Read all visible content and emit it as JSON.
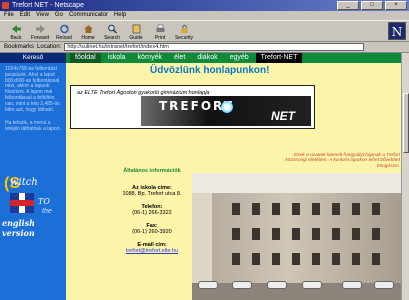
{
  "window": {
    "title": "Trefort NET - Netscape",
    "controls": [
      "_",
      "□",
      "×"
    ]
  },
  "menu": [
    "File",
    "Edit",
    "View",
    "Go",
    "Communicator",
    "Help"
  ],
  "toolbar": {
    "buttons": [
      "Back",
      "Forward",
      "Reload",
      "Home",
      "Search",
      "Guide",
      "Print",
      "Security"
    ],
    "throbber": "N"
  },
  "location": {
    "bookmarks_label": "Bookmarks",
    "location_label": "Location:",
    "url": "http://sulinet.hu/intranet/trefort/index4.htm"
  },
  "left_panel": {
    "title": "Kereső",
    "text1": "1024x768-as felbontást javaslunk. Ahol a lapot 800x600-as felbontással nézi, akkor a lapunk frissíteni. A lapon mai felbontással a feltöltés van, mint a kép 2,485-ös bitre azt, hogy látható.",
    "text2": "Ha tetszik, a menü a tetején láthatóak a lapon.",
    "switch_word": "witch",
    "switch_to": "TO",
    "switch_the": "the",
    "switch_english": "english version"
  },
  "tabs": [
    "főoldal",
    "iskola",
    "környék",
    "élet",
    "diákok",
    "egyéb",
    "Trefort-NET"
  ],
  "main": {
    "welcome": "Üdvözlünk honlapunkon!",
    "banner_subtitle": "az ELTE Trefort Ágoston gyakorló gimnázium honlapja",
    "logo_left": "TREFORT",
    "logo_right": "NET",
    "red_note": "Ezek a rovatok kiemelt hangsúlyt kapnak a Trefort közösségi életében. A konkrét lapokon lehet bővebbet böngészni.",
    "info_head": "Általános információk",
    "addr_label": "Az iskola címe:",
    "addr_value": "1088, Bp. Trefort utca 8.",
    "phone_label": "Telefon:",
    "phone_value": "(06-1) 266-3322",
    "fax_label": "Fax:",
    "fax_value": "(06-1) 260-3920",
    "email_label": "E-mail cím:",
    "email_value": "trefort@trefort.elte.hu"
  }
}
